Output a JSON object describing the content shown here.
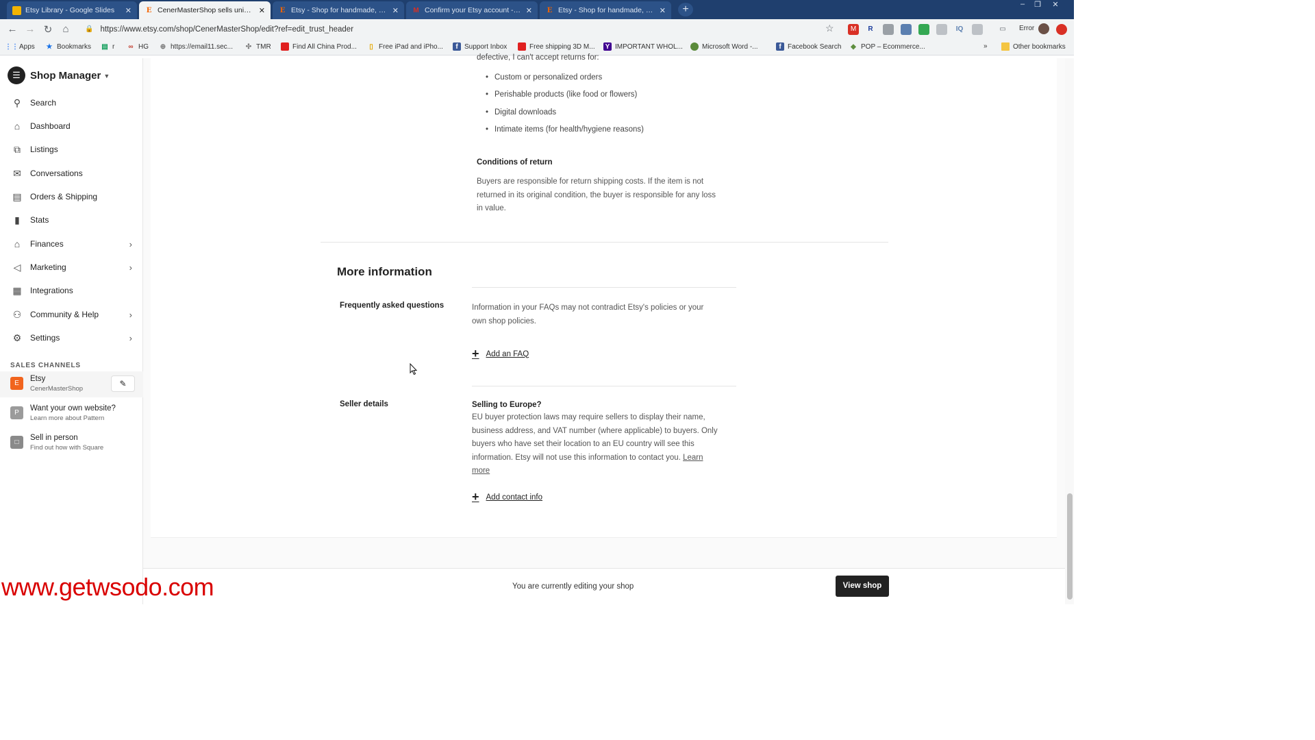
{
  "browser": {
    "tabs": [
      {
        "title": "Etsy Library - Google Slides",
        "icon": "slides"
      },
      {
        "title": "CenerMasterShop sells unique t-",
        "icon": "etsy"
      },
      {
        "title": "Etsy - Shop for handmade, vintage",
        "icon": "etsy"
      },
      {
        "title": "Confirm your Etsy account - cenc",
        "icon": "gmail"
      },
      {
        "title": "Etsy - Shop for handmade, vintage",
        "icon": "etsy"
      }
    ],
    "close_glyph": "✕",
    "new_tab_glyph": "+",
    "url": "https://www.etsy.com/shop/CenerMasterShop/edit?ref=edit_trust_header",
    "error_label": "Error",
    "bookmarks": [
      "Apps",
      "Bookmarks",
      "r",
      "HG",
      "https://email11.sec...",
      "TMR",
      "Find All China Prod...",
      "Free iPad and iPho...",
      "Support Inbox",
      "Free shipping 3D M...",
      "IMPORTANT WHOL...",
      "Microsoft Word -...",
      "Facebook Search",
      "POP – Ecommerce..."
    ],
    "other_bookmarks": "Other bookmarks",
    "more_bookmarks": "»"
  },
  "sidebar": {
    "title": "Shop Manager",
    "nav": [
      {
        "label": "Search",
        "icon": "search-icon",
        "chevron": false
      },
      {
        "label": "Dashboard",
        "icon": "home-icon",
        "chevron": false
      },
      {
        "label": "Listings",
        "icon": "listings-icon",
        "chevron": false
      },
      {
        "label": "Conversations",
        "icon": "mail-icon",
        "chevron": false
      },
      {
        "label": "Orders & Shipping",
        "icon": "clipboard-icon",
        "chevron": false
      },
      {
        "label": "Stats",
        "icon": "bar-chart-icon",
        "chevron": false
      },
      {
        "label": "Finances",
        "icon": "bank-icon",
        "chevron": true
      },
      {
        "label": "Marketing",
        "icon": "megaphone-icon",
        "chevron": true
      },
      {
        "label": "Integrations",
        "icon": "grid-icon",
        "chevron": false
      },
      {
        "label": "Community & Help",
        "icon": "people-icon",
        "chevron": true
      },
      {
        "label": "Settings",
        "icon": "gear-icon",
        "chevron": true
      }
    ],
    "sales_channels_title": "SALES CHANNELS",
    "channels": [
      {
        "name": "Etsy",
        "sub": "CenerMasterShop",
        "badge": "E",
        "color": "#f1641e"
      },
      {
        "name": "Want your own website?",
        "sub": "Learn more about Pattern",
        "badge": "P",
        "color": "#9b9b9b"
      },
      {
        "name": "Sell in person",
        "sub": "Find out how with Square",
        "badge": "□",
        "color": "#8a8a8a"
      }
    ]
  },
  "content": {
    "cut_line": "defective, I can't accept returns for:",
    "return_exceptions": [
      "Custom or personalized orders",
      "Perishable products (like food or flowers)",
      "Digital downloads",
      "Intimate items (for health/hygiene reasons)"
    ],
    "conditions_title": "Conditions of return",
    "conditions_lines": [
      "Buyers are responsible for return shipping costs. If the item is not",
      "returned in its original condition, the buyer is responsible for any loss",
      "in value."
    ],
    "more_info_title": "More information",
    "faq_label": "Frequently asked questions",
    "faq_lines": [
      "Information in your FAQs may not contradict Etsy's policies or your",
      "own shop policies."
    ],
    "add_faq": "Add an FAQ",
    "seller_details_label": "Seller details",
    "selling_europe": "Selling to Europe?",
    "eu_lines": [
      "EU buyer protection laws may require sellers to display their name,",
      "business address, and VAT number (where applicable) to buyers. Only",
      "buyers who have set their location to an EU country will see this",
      "information. Etsy will not use this information to contact you."
    ],
    "learn": "Learn",
    "more": "more",
    "add_contact": "Add contact info"
  },
  "bottom": {
    "editing_text": "You are currently editing your shop",
    "view_shop": "View shop"
  },
  "watermark": "www.getwsodo.com"
}
